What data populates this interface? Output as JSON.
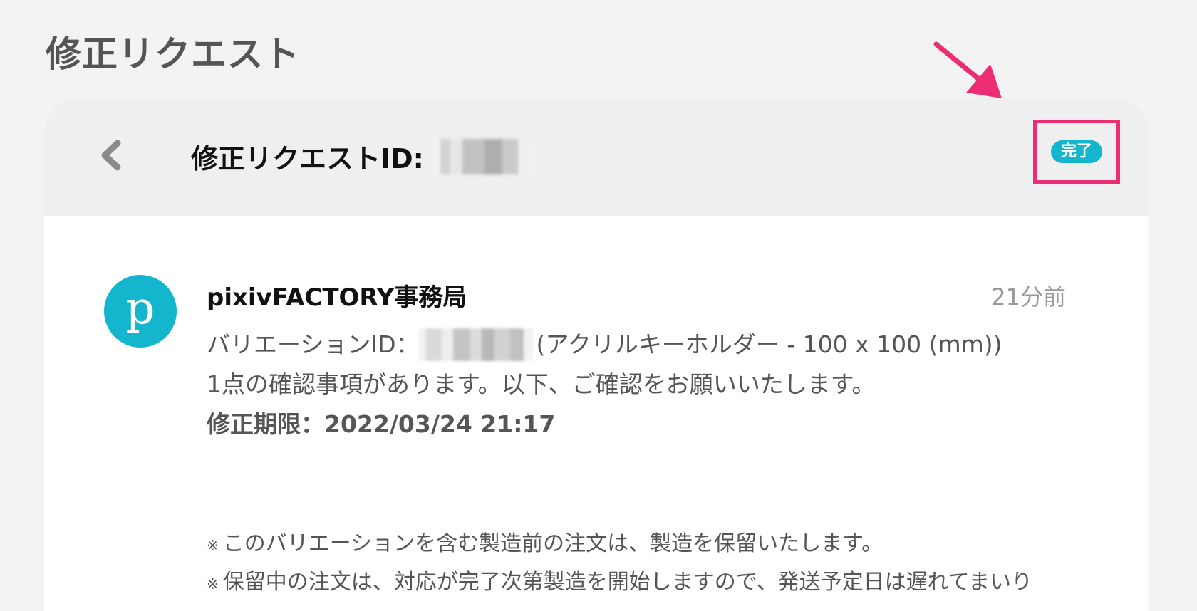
{
  "page": {
    "title": "修正リクエスト"
  },
  "header": {
    "request_label": "修正リクエストID:",
    "status": "完了",
    "accent_color": "#ec2d73",
    "badge_color": "#13b6cc"
  },
  "message": {
    "sender": "pixivFACTORY事務局",
    "avatar_letter": "p",
    "time": "21分前",
    "variation_label": "バリエーションID：",
    "variation_product": "(アクリルキーホルダー - 100 x 100 (mm))",
    "line2": "1点の確認事項があります。以下、ご確認をお願いいたします。",
    "deadline": "修正期限：2022/03/24 21:17"
  },
  "notes": {
    "mark": "※",
    "items": [
      "このバリエーションを含む製造前の注文は、製造を保留いたします。",
      "保留中の注文は、対応が完了次第製造を開始しますので、発送予定日は遅れてまいり"
    ]
  },
  "icons": {
    "back": "chevron-left-icon",
    "annotation": "arrow-icon"
  }
}
